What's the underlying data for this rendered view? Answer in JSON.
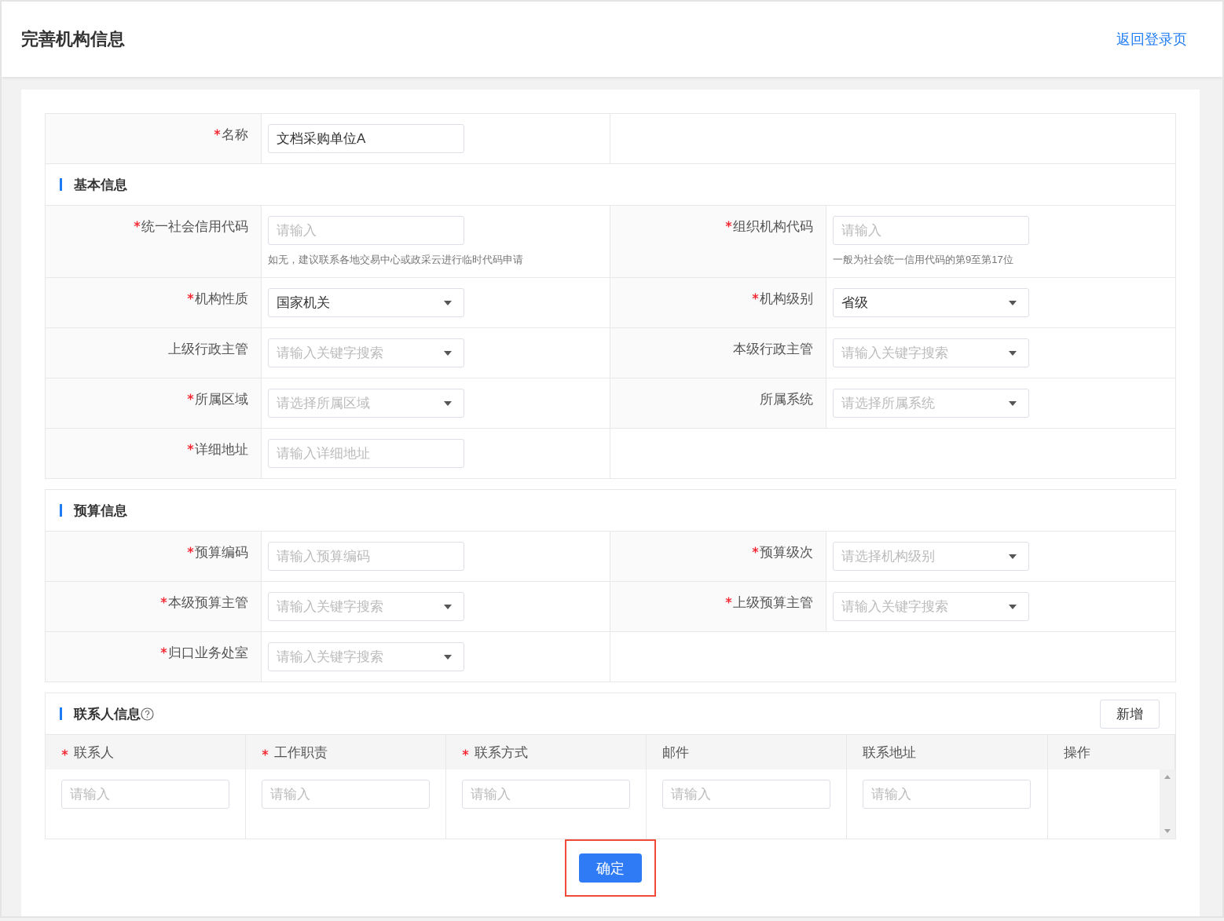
{
  "header": {
    "title": "完善机构信息",
    "link": "返回登录页"
  },
  "name_row": [
    {
      "label": "名称",
      "required": true,
      "kind": "input",
      "value": "文档采购单位A"
    }
  ],
  "sections": [
    {
      "title": "基本信息",
      "rows": [
        [
          {
            "label": "统一社会信用代码",
            "required": true,
            "kind": "input",
            "placeholder": "请输入",
            "hint": "如无，建议联系各地交易中心或政采云进行临时代码申请"
          },
          {
            "label": "组织机构代码",
            "required": true,
            "kind": "input",
            "placeholder": "请输入",
            "hint": "一般为社会统一信用代码的第9至第17位"
          }
        ],
        [
          {
            "label": "机构性质",
            "required": true,
            "kind": "select",
            "value": "国家机关"
          },
          {
            "label": "机构级别",
            "required": true,
            "kind": "select",
            "value": "省级"
          }
        ],
        [
          {
            "label": "上级行政主管",
            "required": false,
            "kind": "select",
            "placeholder": "请输入关键字搜索"
          },
          {
            "label": "本级行政主管",
            "required": false,
            "kind": "select",
            "placeholder": "请输入关键字搜索"
          }
        ],
        [
          {
            "label": "所属区域",
            "required": true,
            "kind": "select",
            "placeholder": "请选择所属区域"
          },
          {
            "label": "所属系统",
            "required": false,
            "kind": "select",
            "placeholder": "请选择所属系统"
          }
        ],
        [
          {
            "label": "详细地址",
            "required": true,
            "kind": "input",
            "placeholder": "请输入详细地址"
          }
        ]
      ]
    },
    {
      "title": "预算信息",
      "rows": [
        [
          {
            "label": "预算编码",
            "required": true,
            "kind": "input",
            "placeholder": "请输入预算编码"
          },
          {
            "label": "预算级次",
            "required": true,
            "kind": "select",
            "placeholder": "请选择机构级别"
          }
        ],
        [
          {
            "label": "本级预算主管",
            "required": true,
            "kind": "select",
            "placeholder": "请输入关键字搜索"
          },
          {
            "label": "上级预算主管",
            "required": true,
            "kind": "select",
            "placeholder": "请输入关键字搜索"
          }
        ],
        [
          {
            "label": "归口业务处室",
            "required": true,
            "kind": "select",
            "placeholder": "请输入关键字搜索"
          }
        ]
      ]
    }
  ],
  "contacts": {
    "title": "联系人信息",
    "add_button": "新增",
    "columns": [
      {
        "label": "联系人",
        "required": true
      },
      {
        "label": "工作职责",
        "required": true
      },
      {
        "label": "联系方式",
        "required": true
      },
      {
        "label": "邮件",
        "required": false
      },
      {
        "label": "联系地址",
        "required": false
      },
      {
        "label": "操作",
        "required": false
      }
    ],
    "rows": [
      {
        "cells": [
          {
            "placeholder": "请输入"
          },
          {
            "placeholder": "请输入"
          },
          {
            "placeholder": "请输入"
          },
          {
            "placeholder": "请输入"
          },
          {
            "placeholder": "请输入"
          }
        ]
      }
    ]
  },
  "submit": {
    "label": "确定",
    "highlighted": true
  }
}
